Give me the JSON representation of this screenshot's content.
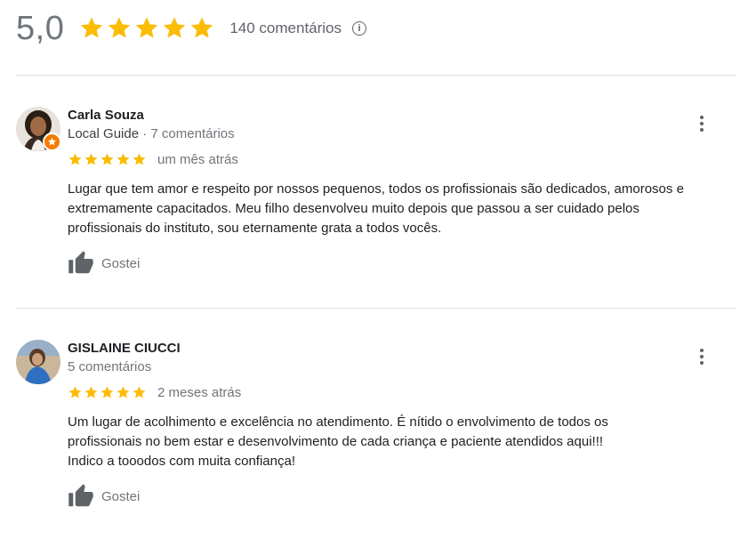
{
  "summary": {
    "rating": "5,0",
    "stars": 5,
    "count_text": "140 comentários",
    "info_icon": "info-icon"
  },
  "colors": {
    "star": "#fbbc04",
    "text_secondary": "#70757a",
    "badge": "#f57c00"
  },
  "reviews": [
    {
      "name": "Carla Souza",
      "guide_label": "Local Guide",
      "separator": " · ",
      "comments": "7 comentários",
      "stars": 5,
      "when": "um mês atrás",
      "text_lines": [
        "Lugar que tem amor e respeito por nossos pequenos, todos os profissionais são dedicados, amorosos e",
        "extremamente capacitados. Meu filho desenvolveu muito depois que passou a ser cuidado pelos",
        "profissionais do instituto, sou eternamente grata a todos vocês."
      ],
      "like_label": "Gostei"
    },
    {
      "name": "GISLAINE CIUCCI",
      "comments": "5 comentários",
      "stars": 5,
      "when": "2 meses atrás",
      "text_lines": [
        "Um lugar de acolhimento e excelência no atendimento. É nítido o envolvimento de todos os",
        "profissionais no bem estar e desenvolvimento de cada criança e paciente atendidos aqui!!!",
        "Indico a tooodos com muita confiança!"
      ],
      "like_label": "Gostei"
    }
  ]
}
